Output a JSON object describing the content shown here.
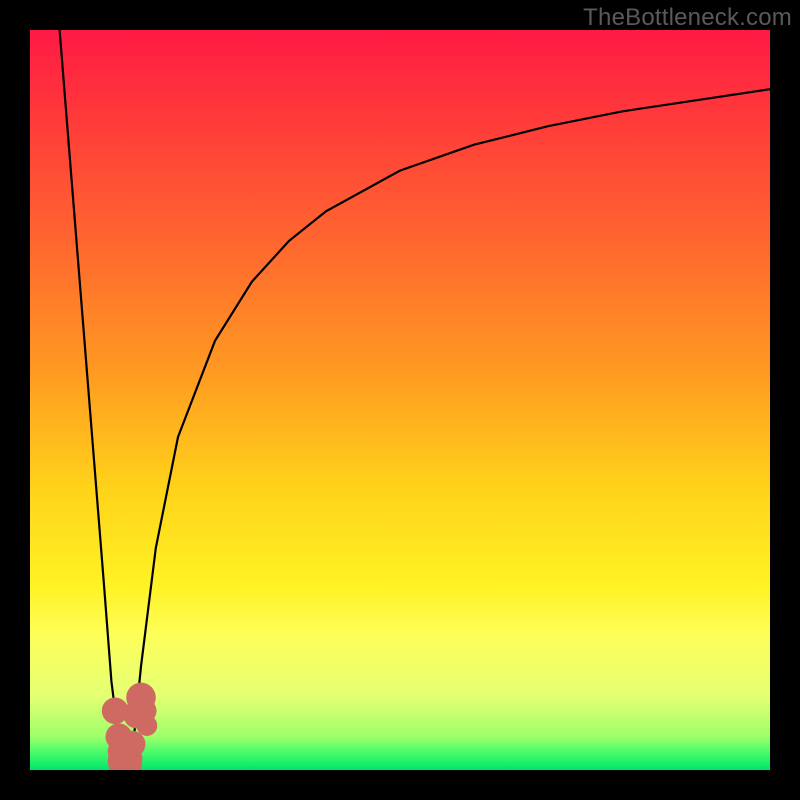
{
  "brand": "TheBottleneck.com",
  "chart_data": {
    "type": "line",
    "title": "",
    "xlabel": "",
    "ylabel": "",
    "xlim": [
      0,
      100
    ],
    "ylim": [
      0,
      100
    ],
    "curve": {
      "name": "bottleneck-curve",
      "x": [
        4,
        6,
        8,
        10,
        11,
        12,
        12.5,
        13,
        13.5,
        14,
        15,
        17,
        20,
        25,
        30,
        35,
        40,
        50,
        60,
        70,
        80,
        90,
        100
      ],
      "y": [
        100,
        75,
        50,
        25,
        12,
        4,
        1,
        0.5,
        1,
        4,
        14,
        30,
        45,
        58,
        66,
        71.5,
        75.5,
        81,
        84.5,
        87,
        89,
        90.5,
        92
      ]
    },
    "markers": {
      "name": "sample-points",
      "color": "#cf6a63",
      "points": [
        {
          "x": 11.5,
          "y": 8,
          "r": 1.8
        },
        {
          "x": 12.0,
          "y": 4.5,
          "r": 1.8
        },
        {
          "x": 12.3,
          "y": 2.5,
          "r": 1.8
        },
        {
          "x": 12.6,
          "y": 1.2,
          "r": 2.1
        },
        {
          "x": 13.0,
          "y": 0.6,
          "r": 2.1
        },
        {
          "x": 13.4,
          "y": 1.5,
          "r": 1.8
        },
        {
          "x": 13.8,
          "y": 3.5,
          "r": 1.8
        },
        {
          "x": 14.5,
          "y": 7.5,
          "r": 1.9
        },
        {
          "x": 15.0,
          "y": 9.8,
          "r": 2.0
        },
        {
          "x": 15.5,
          "y": 8.0,
          "r": 1.6
        },
        {
          "x": 15.8,
          "y": 6.0,
          "r": 1.4
        }
      ]
    }
  }
}
